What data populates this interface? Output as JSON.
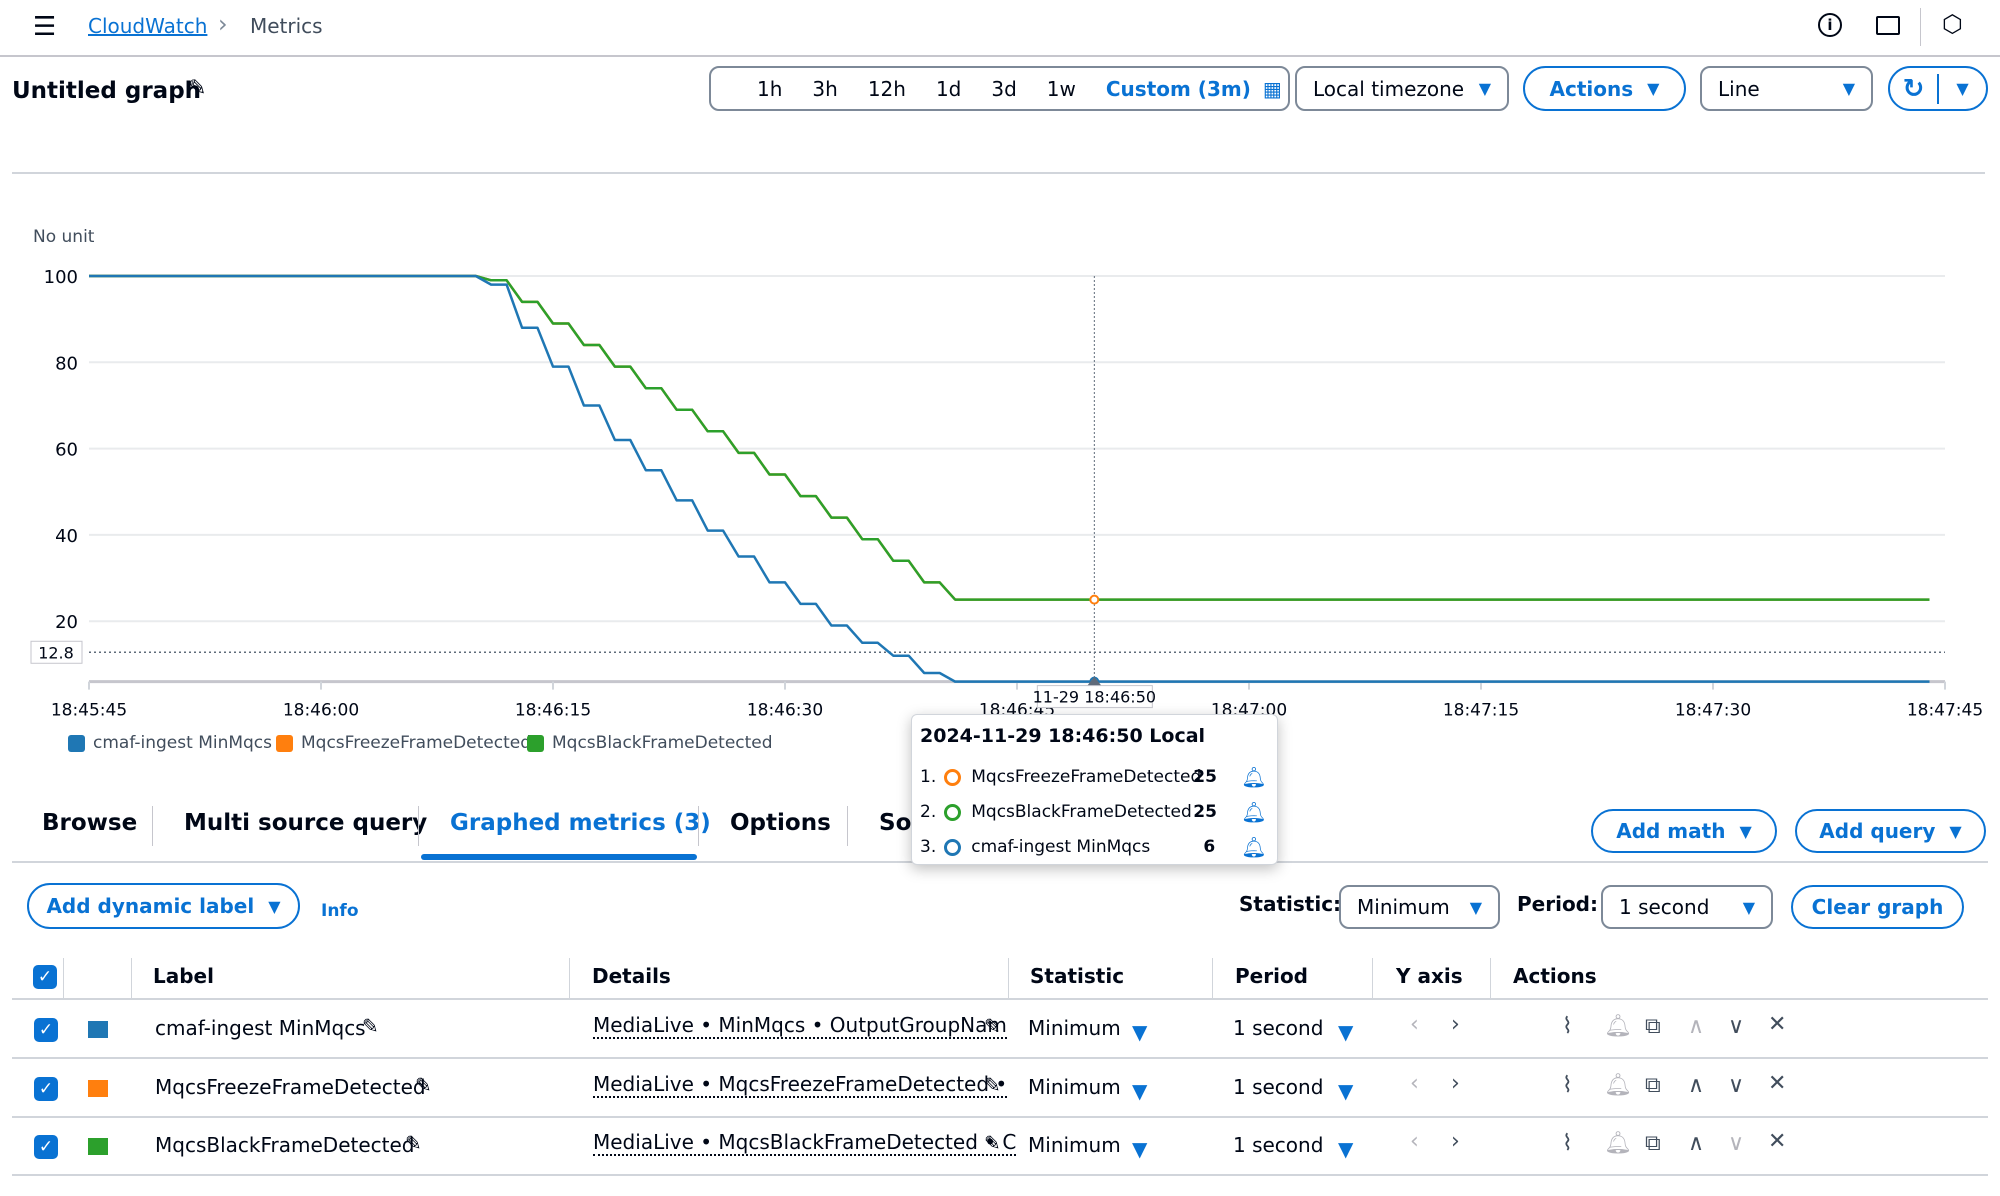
{
  "breadcrumb": {
    "root": "CloudWatch",
    "current": "Metrics"
  },
  "icons": {
    "menu": "hamburger-icon",
    "info": "info-icon",
    "folder": "folder-icon",
    "settings": "settings-icon",
    "edit": "pencil-icon",
    "calendar": "calendar-icon",
    "refresh": "refresh-icon",
    "bell": "bell-icon"
  },
  "graph": {
    "title": "Untitled graph"
  },
  "toolbar": {
    "ranges": [
      "1h",
      "3h",
      "12h",
      "1d",
      "3d",
      "1w"
    ],
    "custom": "Custom (3m)",
    "timezone": "Local timezone",
    "actions": "Actions",
    "chart_type": "Line"
  },
  "colors": {
    "accent": "#0972d3",
    "series_blue": "#1f77b4",
    "series_orange": "#ff7f0e",
    "series_green": "#2ca02c"
  },
  "chart_data": {
    "type": "line",
    "ylabel": "No unit",
    "ylim": [
      6,
      100
    ],
    "y_ticks": [
      20,
      40,
      60,
      80,
      100
    ],
    "y_marker": "12.8",
    "x_ticks": [
      "18:45:45",
      "18:46:00",
      "18:46:15",
      "18:46:30",
      "18:46:45",
      "18:47:00",
      "18:47:15",
      "18:47:30",
      "18:47:45"
    ],
    "grid": true,
    "legend": "bottom-left",
    "crosshair": {
      "time": "18:46:50",
      "label": "11-29 18:46:50"
    },
    "x": [
      "18:45:45",
      "18:46:10",
      "18:46:11",
      "18:46:12",
      "18:46:13",
      "18:46:14",
      "18:46:15",
      "18:46:16",
      "18:46:17",
      "18:46:18",
      "18:46:19",
      "18:46:20",
      "18:46:21",
      "18:46:22",
      "18:46:23",
      "18:46:24",
      "18:46:25",
      "18:46:26",
      "18:46:27",
      "18:46:28",
      "18:46:29",
      "18:46:30",
      "18:46:31",
      "18:46:32",
      "18:46:33",
      "18:46:34",
      "18:46:35",
      "18:46:36",
      "18:46:37",
      "18:46:38",
      "18:46:39",
      "18:46:40",
      "18:46:41",
      "18:47:44"
    ],
    "series": [
      {
        "name": "cmaf-ingest MinMqcs",
        "color": "#1f77b4",
        "values": [
          100,
          100,
          98,
          98,
          88,
          88,
          79,
          79,
          70,
          70,
          62,
          62,
          55,
          55,
          48,
          48,
          41,
          41,
          35,
          35,
          29,
          29,
          24,
          24,
          19,
          19,
          15,
          15,
          12,
          12,
          8,
          8,
          6,
          6
        ]
      },
      {
        "name": "MqcsFreezeFrameDetected",
        "color": "#ff7f0e",
        "values": [
          100,
          100,
          99,
          99,
          94,
          94,
          89,
          89,
          84,
          84,
          79,
          79,
          74,
          74,
          69,
          69,
          64,
          64,
          59,
          59,
          54,
          54,
          49,
          49,
          44,
          44,
          39,
          39,
          34,
          34,
          29,
          29,
          25,
          25
        ]
      },
      {
        "name": "MqcsBlackFrameDetected",
        "color": "#2ca02c",
        "values": [
          100,
          100,
          99,
          99,
          94,
          94,
          89,
          89,
          84,
          84,
          79,
          79,
          74,
          74,
          69,
          69,
          64,
          64,
          59,
          59,
          54,
          54,
          49,
          49,
          44,
          44,
          39,
          39,
          34,
          34,
          29,
          29,
          25,
          25
        ]
      }
    ]
  },
  "tooltip": {
    "title": "2024-11-29 18:46:50 Local",
    "rows": [
      {
        "index": "1.",
        "name": "MqcsFreezeFrameDetected",
        "value": "25",
        "color": "#ff7f0e"
      },
      {
        "index": "2.",
        "name": "MqcsBlackFrameDetected",
        "value": "25",
        "color": "#2ca02c"
      },
      {
        "index": "3.",
        "name": "cmaf-ingest MinMqcs",
        "value": "6",
        "color": "#1f77b4"
      }
    ]
  },
  "tabs": [
    "Browse",
    "Multi source query",
    "Graphed metrics (3)",
    "Options",
    "So"
  ],
  "buttons": {
    "add_math": "Add math",
    "add_query": "Add query",
    "add_dynamic_label": "Add dynamic label",
    "info": "Info",
    "clear_graph": "Clear graph"
  },
  "controls": {
    "statistic_label": "Statistic:",
    "statistic": "Minimum",
    "period_label": "Period:",
    "period": "1 second"
  },
  "table": {
    "headers": [
      "Label",
      "Details",
      "Statistic",
      "Period",
      "Y axis",
      "Actions"
    ],
    "rows": [
      {
        "label": "cmaf-ingest MinMqcs",
        "details": "MediaLive • MinMqcs • OutputGroupNam",
        "statistic": "Minimum",
        "period": "1 second",
        "color": "#1f77b4",
        "checked": true
      },
      {
        "label": "MqcsFreezeFrameDetected",
        "details": "MediaLive • MqcsFreezeFrameDetected •",
        "statistic": "Minimum",
        "period": "1 second",
        "color": "#ff7f0e",
        "checked": true
      },
      {
        "label": "MqcsBlackFrameDetected",
        "details": "MediaLive • MqcsBlackFrameDetected • C",
        "statistic": "Minimum",
        "period": "1 second",
        "color": "#2ca02c",
        "checked": true
      }
    ]
  }
}
